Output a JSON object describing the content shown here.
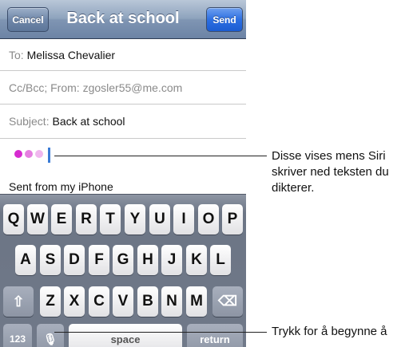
{
  "navbar": {
    "cancel": "Cancel",
    "title": "Back at school",
    "send": "Send"
  },
  "fields": {
    "to_label": "To:",
    "to_value": "Melissa Chevalier",
    "cc_label": "Cc/Bcc; From:",
    "cc_value": "zgosler55@me.com",
    "subject_label": "Subject:",
    "subject_value": "Back at school"
  },
  "body": {
    "signature": "Sent from my iPhone"
  },
  "dictation_dots_colors": [
    "#d62bd0",
    "#e57fe0",
    "#f0b7ee"
  ],
  "keyboard": {
    "row1": [
      "Q",
      "W",
      "E",
      "R",
      "T",
      "Y",
      "U",
      "I",
      "O",
      "P"
    ],
    "row2": [
      "A",
      "S",
      "D",
      "F",
      "G",
      "H",
      "J",
      "K",
      "L"
    ],
    "row3": [
      "Z",
      "X",
      "C",
      "V",
      "B",
      "N",
      "M"
    ],
    "numbers": "123",
    "space": "space",
    "return": "return",
    "shift_icon": "⇧",
    "delete_icon": "⌫",
    "mic_icon": "🎙"
  },
  "annotations": {
    "siri_line1": "Disse vises mens Siri",
    "siri_line2": "skriver ned teksten du",
    "siri_line3": "dikterer.",
    "mic_text": "Trykk for å begynne å"
  }
}
